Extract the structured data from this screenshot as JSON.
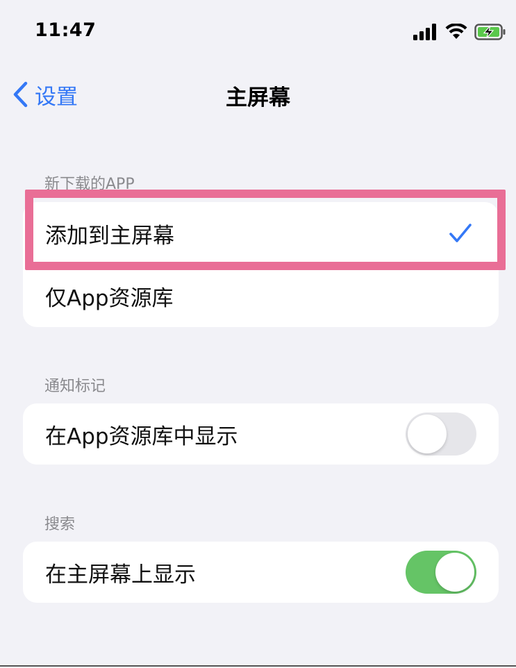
{
  "status_bar": {
    "time": "11:47"
  },
  "nav": {
    "back_label": "设置",
    "title": "主屏幕"
  },
  "sections": {
    "new_apps": {
      "header": "新下载的APP",
      "options": [
        {
          "label": "添加到主屏幕",
          "selected": true
        },
        {
          "label": "仅App资源库",
          "selected": false
        }
      ]
    },
    "badges": {
      "header": "通知标记",
      "row_label": "在App资源库中显示",
      "toggle_on": false
    },
    "search": {
      "header": "搜索",
      "row_label": "在主屏幕上显示",
      "toggle_on": true
    }
  },
  "colors": {
    "accent": "#3478f6",
    "toggle_on": "#65c466",
    "highlight": "#e96e96",
    "background": "#f2f2f7"
  }
}
